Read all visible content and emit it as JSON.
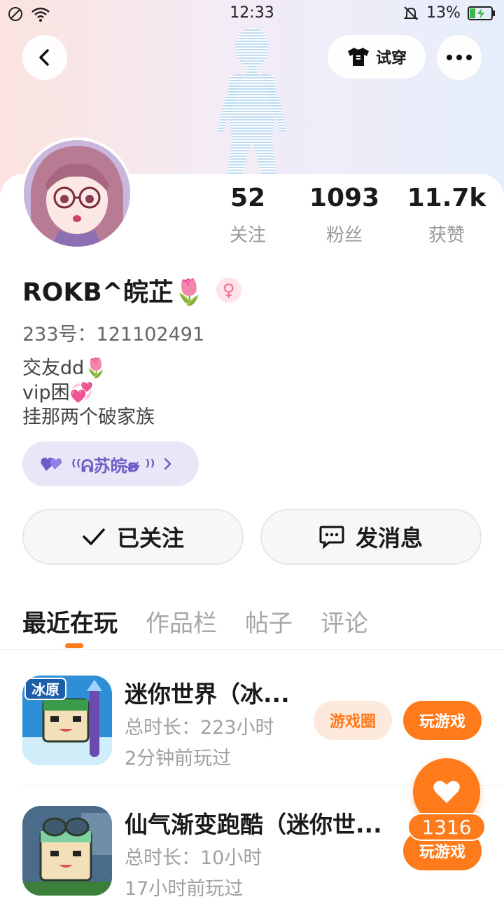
{
  "status_bar": {
    "time": "12:33",
    "battery": "13%"
  },
  "header": {
    "try_on_label": "试穿"
  },
  "stats": [
    {
      "value": "52",
      "label": "关注"
    },
    {
      "value": "1093",
      "label": "粉丝"
    },
    {
      "value": "11.7k",
      "label": "获赞"
    }
  ],
  "profile": {
    "name": "ROKB^皖芷🌷",
    "gender_symbol": "♀",
    "uid": "233号：121102491",
    "bio": [
      "交友dd🌷",
      "vip困💞",
      "挂那两个破家族"
    ],
    "family_label": "⁽⁽ᕱ苏皖ʚ̴̶̷̷ ⁾⁾"
  },
  "actions": {
    "followed_label": "已关注",
    "message_label": "发消息"
  },
  "tabs": [
    "最近在玩",
    "作品栏",
    "帖子",
    "评论"
  ],
  "games": [
    {
      "title": "迷你世界（冰...",
      "duration": "总时长：223小时",
      "last_played": "2分钟前玩过",
      "circle_label": "游戏圈",
      "play_label": "玩游戏",
      "icon_badge": "冰原"
    },
    {
      "title": "仙气渐变跑酷（迷你世...",
      "duration": "总时长：10小时",
      "last_played": "17小时前玩过",
      "play_label": "玩游戏"
    }
  ],
  "like_fab": {
    "count": "1316"
  },
  "colors": {
    "accent": "#ff7a1a",
    "family_purple": "#6e5cc7",
    "chip_bg": "#fde9dc"
  }
}
